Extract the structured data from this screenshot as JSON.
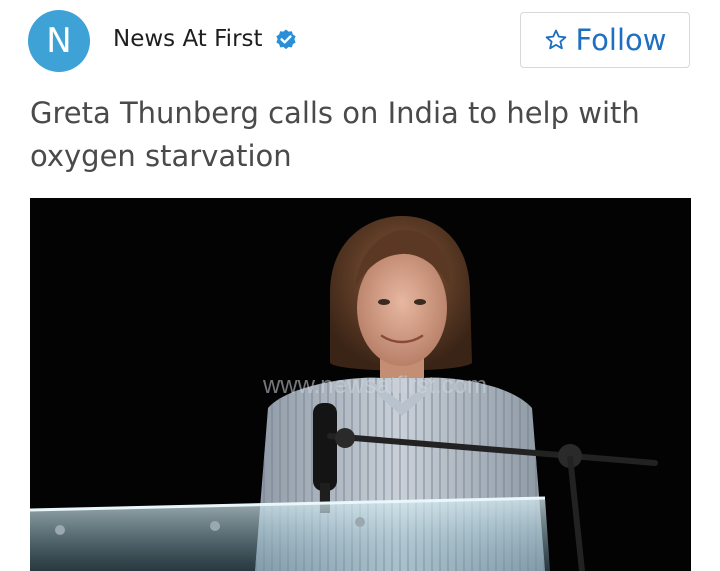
{
  "source": {
    "avatar_letter": "N",
    "name": "News At First",
    "verified_icon": "verified-badge-icon",
    "avatar_color": "#3ea2d6",
    "verified_color": "#2a8fd8"
  },
  "follow_button": {
    "icon": "star-outline-icon",
    "label": "Follow",
    "color": "#1c6fc1"
  },
  "article": {
    "headline": "Greta Thunberg calls on India to help with oxygen starvation",
    "image": {
      "watermark": "www.newsatfirst.com"
    }
  }
}
